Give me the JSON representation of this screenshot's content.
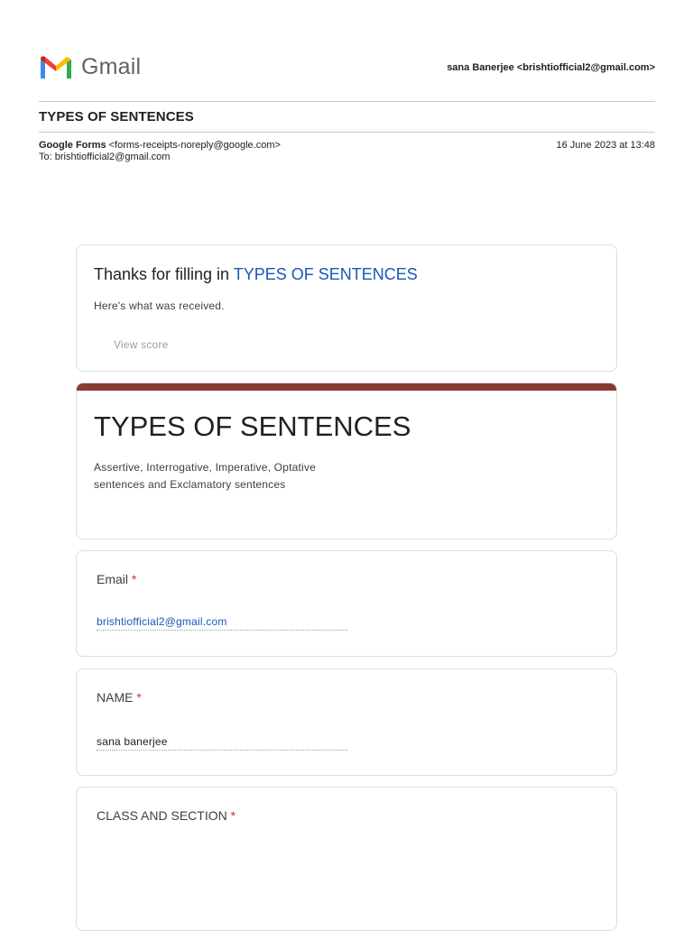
{
  "gmail": {
    "logo_text": "Gmail",
    "account": "sana Banerjee <brishtiofficial2@gmail.com>"
  },
  "email": {
    "subject": "TYPES OF SENTENCES",
    "from_name": "Google Forms",
    "from_address": "<forms-receipts-noreply@google.com>",
    "to": "To: brishtiofficial2@gmail.com",
    "date": "16 June 2023 at 13:48"
  },
  "receipt": {
    "thanks_prefix": "Thanks for filling in",
    "form_link": "TYPES OF SENTENCES",
    "received": "Here's what was received.",
    "view_score": "View score"
  },
  "form": {
    "title": "TYPES OF SENTENCES",
    "description": "Assertive, Interrogative, Imperative, Optative sentences and Exclamatory sentences",
    "accent_color": "#8a3a2e",
    "questions": [
      {
        "label": "Email",
        "required": "*",
        "answer": "brishtiofficial2@gmail.com"
      },
      {
        "label": "NAME",
        "required": "*",
        "answer": "sana banerjee"
      },
      {
        "label": "CLASS AND SECTION",
        "required": "*",
        "answer": ""
      }
    ]
  }
}
